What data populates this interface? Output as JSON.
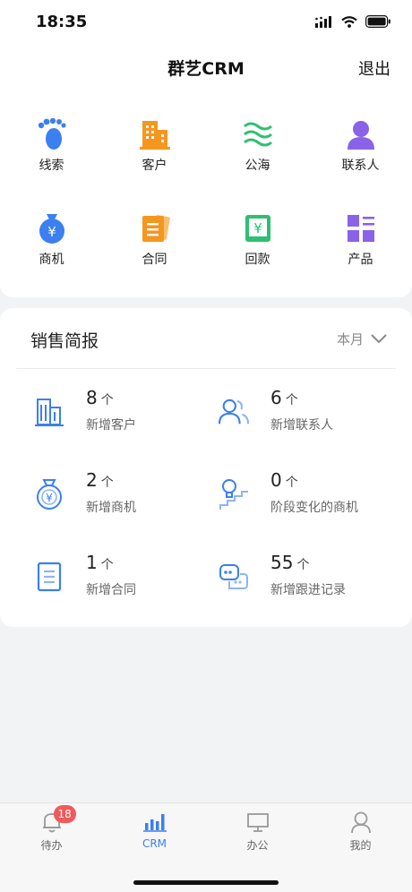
{
  "status_bar": {
    "time": "18:35"
  },
  "header": {
    "title": "群艺CRM",
    "logout_label": "退出"
  },
  "modules": [
    {
      "label": "线索",
      "icon": "footprint-icon",
      "color": "#3b7ff0"
    },
    {
      "label": "客户",
      "icon": "building-icon",
      "color": "#f5961e"
    },
    {
      "label": "公海",
      "icon": "waves-icon",
      "color": "#2fbf71"
    },
    {
      "label": "联系人",
      "icon": "person-icon",
      "color": "#8a62e8"
    },
    {
      "label": "商机",
      "icon": "money-bag-icon",
      "color": "#3b7ff0"
    },
    {
      "label": "合同",
      "icon": "contract-icon",
      "color": "#f5961e"
    },
    {
      "label": "回款",
      "icon": "payment-icon",
      "color": "#2fbf71"
    },
    {
      "label": "产品",
      "icon": "product-grid-icon",
      "color": "#8a62e8"
    }
  ],
  "sales_report": {
    "title": "销售简报",
    "period": "本月",
    "stats": [
      {
        "value": "8",
        "unit": "个",
        "label": "新增客户",
        "icon": "building-outline-icon"
      },
      {
        "value": "6",
        "unit": "个",
        "label": "新增联系人",
        "icon": "contacts-outline-icon"
      },
      {
        "value": "2",
        "unit": "个",
        "label": "新增商机",
        "icon": "money-bag-outline-icon"
      },
      {
        "value": "0",
        "unit": "个",
        "label": "阶段变化的商机",
        "icon": "bulb-stairs-icon"
      },
      {
        "value": "1",
        "unit": "个",
        "label": "新增合同",
        "icon": "document-outline-icon"
      },
      {
        "value": "55",
        "unit": "个",
        "label": "新增跟进记录",
        "icon": "followup-icon"
      }
    ]
  },
  "tabbar": {
    "items": [
      {
        "label": "待办",
        "icon": "bell-icon",
        "badge": "18"
      },
      {
        "label": "CRM",
        "icon": "bar-chart-icon"
      },
      {
        "label": "办公",
        "icon": "monitor-icon"
      },
      {
        "label": "我的",
        "icon": "user-icon"
      }
    ],
    "active_color": "#3b7ff0"
  }
}
